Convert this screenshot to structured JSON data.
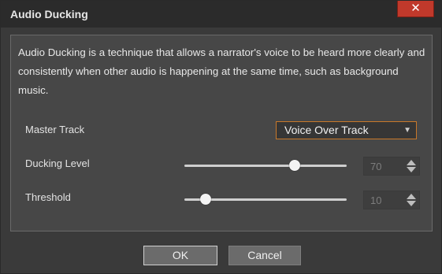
{
  "window": {
    "title": "Audio Ducking",
    "close_glyph": "✕"
  },
  "description": "Audio Ducking is a technique that allows a narrator's voice to be heard more clearly and consistently when other audio is happening at the same time, such as background music.",
  "master_track": {
    "label": "Master Track",
    "selected": "Voice Over Track",
    "caret": "▼"
  },
  "ducking_level": {
    "label": "Ducking Level",
    "value": "70",
    "slider_fraction": 0.68
  },
  "threshold": {
    "label": "Threshold",
    "value": "10",
    "slider_fraction": 0.13
  },
  "buttons": {
    "ok": "OK",
    "cancel": "Cancel"
  },
  "colors": {
    "close_button": "#c0392b",
    "select_border": "#c8782a"
  }
}
